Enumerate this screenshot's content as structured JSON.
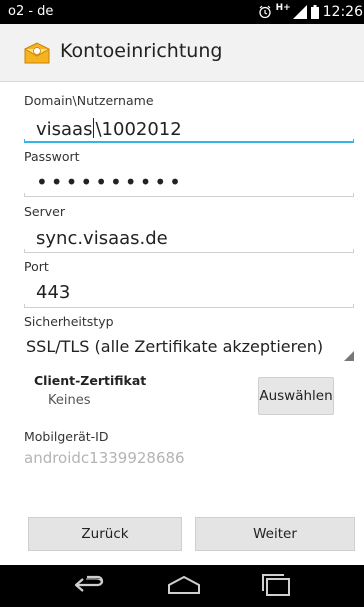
{
  "status_bar": {
    "carrier": "o2 - de",
    "network": "H+",
    "time": "12:26"
  },
  "action_bar": {
    "title": "Kontoeinrichtung",
    "icon": "email-app-icon"
  },
  "form": {
    "domain_user": {
      "label": "Domain\\Nutzername",
      "value_before_cursor": "visaas",
      "value_after_cursor": "\\1002012"
    },
    "password": {
      "label": "Passwort",
      "masked_value": "••••••••••"
    },
    "server": {
      "label": "Server",
      "value": "sync.visaas.de"
    },
    "port": {
      "label": "Port",
      "value": "443"
    },
    "security": {
      "label": "Sicherheitstyp",
      "selected": "SSL/TLS (alle Zertifikate akzeptieren)"
    },
    "client_cert": {
      "label": "Client-Zertifikat",
      "value": "Keines",
      "button": "Auswählen"
    },
    "device_id": {
      "label": "Mobilgerät-ID",
      "value": "androidc1339928686"
    }
  },
  "buttons": {
    "back": "Zurück",
    "next": "Weiter"
  },
  "navigation": {
    "back": "back-icon",
    "home": "home-icon",
    "recents": "recent-apps-icon"
  },
  "colors": {
    "focus": "#33b5e5",
    "status_bar": "#000000",
    "action_bar": "#f2f2f2"
  }
}
